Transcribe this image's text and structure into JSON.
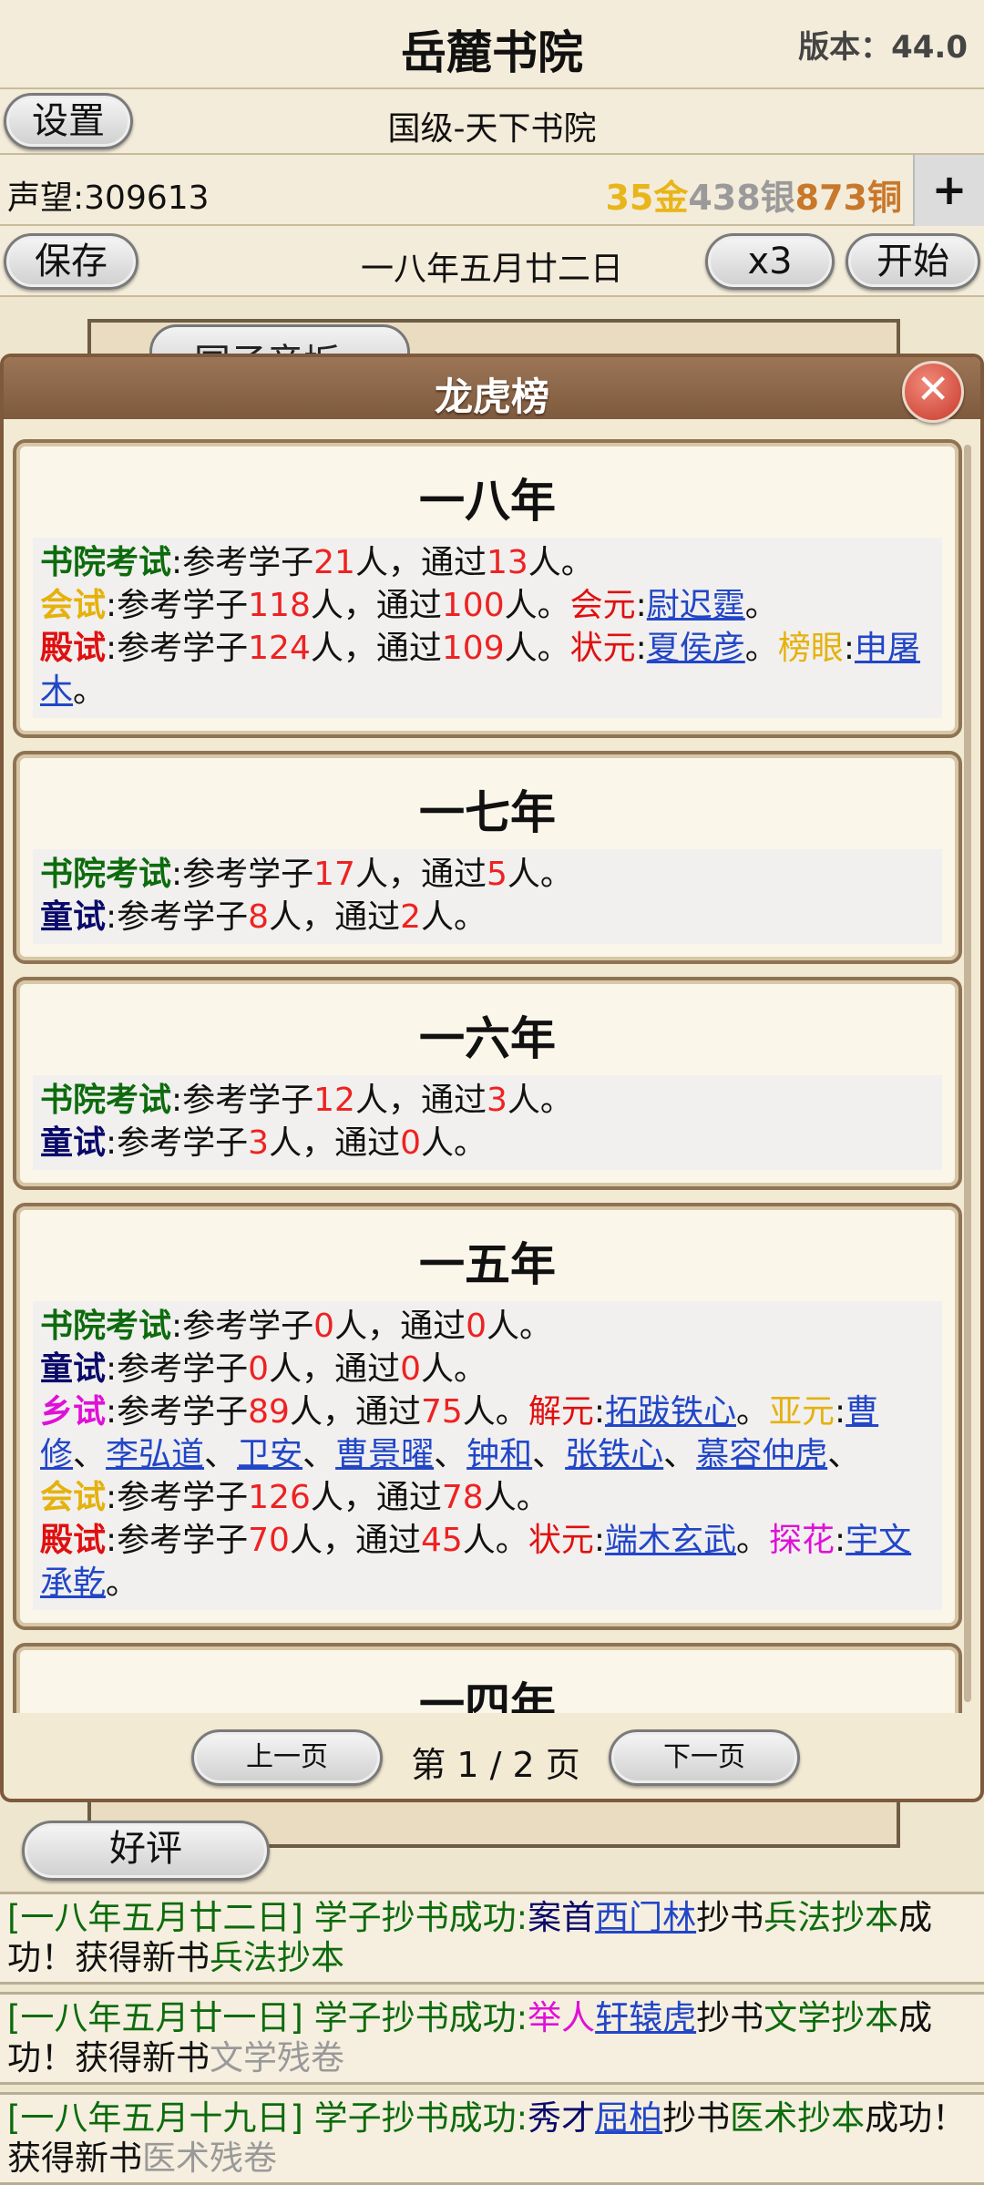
{
  "header": {
    "title": "岳麓书院",
    "version": "版本：44.0"
  },
  "top": {
    "settings_label": "设置",
    "rank": "国级-天下书院",
    "reputation": "声望:309613",
    "gold": "35金",
    "silver": "438银",
    "copper": "873铜",
    "plus_label": "+",
    "save_label": "保存",
    "date": "一八年五月廿二日",
    "speed_label": "x3",
    "start_label": "开始"
  },
  "background": {
    "tab_label": "国子音坂"
  },
  "dialog": {
    "title": "龙虎榜",
    "close_icon": "close-icon",
    "cards": [
      {
        "year": "一八年",
        "l1": {
          "label": "书院考试",
          "t1": ":参考学子",
          "n1": "21",
          "t2": "人，通过",
          "n2": "13",
          "t3": "人。"
        },
        "l2": {
          "label": "会试",
          "t1": ":参考学子",
          "n1": "118",
          "t2": "人，通过",
          "n2": "100",
          "t3": "人。",
          "title1": "会元",
          "name1": "尉迟霆",
          "end": "。"
        },
        "l3": {
          "label": "殿试",
          "t1": ":参考学子",
          "n1": "124",
          "t2": "人，通过",
          "n2": "109",
          "t3": "人。",
          "title1": "状元",
          "name1": "夏侯彦",
          "sep": "。",
          "title2": "榜眼",
          "name2": "申屠木",
          "end": "。"
        }
      },
      {
        "year": "一七年",
        "l1": {
          "label": "书院考试",
          "t1": ":参考学子",
          "n1": "17",
          "t2": "人，通过",
          "n2": "5",
          "t3": "人。"
        },
        "l2": {
          "label": "童试",
          "t1": ":参考学子",
          "n1": "8",
          "t2": "人，通过",
          "n2": "2",
          "t3": "人。"
        }
      },
      {
        "year": "一六年",
        "l1": {
          "label": "书院考试",
          "t1": ":参考学子",
          "n1": "12",
          "t2": "人，通过",
          "n2": "3",
          "t3": "人。"
        },
        "l2": {
          "label": "童试",
          "t1": ":参考学子",
          "n1": "3",
          "t2": "人，通过",
          "n2": "0",
          "t3": "人。"
        }
      },
      {
        "year": "一五年",
        "l1": {
          "label": "书院考试",
          "t1": ":参考学子",
          "n1": "0",
          "t2": "人，通过",
          "n2": "0",
          "t3": "人。"
        },
        "l2": {
          "label": "童试",
          "t1": ":参考学子",
          "n1": "0",
          "t2": "人，通过",
          "n2": "0",
          "t3": "人。"
        },
        "l3": {
          "label": "乡试",
          "t1": ":参考学子",
          "n1": "89",
          "t2": "人，通过",
          "n2": "75",
          "t3": "人。",
          "title1": "解元",
          "name1": "拓跋铁心",
          "sep": "。",
          "title2": "亚元",
          "names": [
            "曹修",
            "李弘道",
            "卫安",
            "曹景曜",
            "钟和",
            "张铁心",
            "慕容仲虎"
          ],
          "name_sep": "、"
        },
        "l4": {
          "label": "会试",
          "t1": ":参考学子",
          "n1": "126",
          "t2": "人，通过",
          "n2": "78",
          "t3": "人。"
        },
        "l5": {
          "label": "殿试",
          "t1": ":参考学子",
          "n1": "70",
          "t2": "人，通过",
          "n2": "45",
          "t3": "人。",
          "title1": "状元",
          "name1": "端木玄武",
          "sep": "。",
          "title2": "探花",
          "name2": "宇文承乾",
          "end": "。"
        }
      },
      {
        "year": "一四年"
      }
    ],
    "pager": {
      "prev": "上一页",
      "page": "第 1 / 2 页",
      "next": "下一页"
    }
  },
  "review_label": "好评",
  "log": [
    {
      "date": "[一八年五月廿二日]",
      "msg": " 学子抄书成功:",
      "rank": "案首",
      "name": "西门林",
      "mid": "抄书",
      "book": "兵法抄本",
      "after": "成功！获得新书",
      "book2": "兵法抄本"
    },
    {
      "date": "[一八年五月廿一日]",
      "msg": " 学子抄书成功:",
      "rank": "举人",
      "name": "轩辕虎",
      "mid": "抄书",
      "book": "文学抄本",
      "after": "成功！获得新书",
      "book2": "文学残卷"
    },
    {
      "date": "[一八年五月十九日]",
      "msg": " 学子抄书成功:",
      "rank": "秀才",
      "name": "屈柏",
      "mid": "抄书",
      "book": "医术抄本",
      "after": "成功！获得新书",
      "book2": "医术残卷"
    }
  ]
}
